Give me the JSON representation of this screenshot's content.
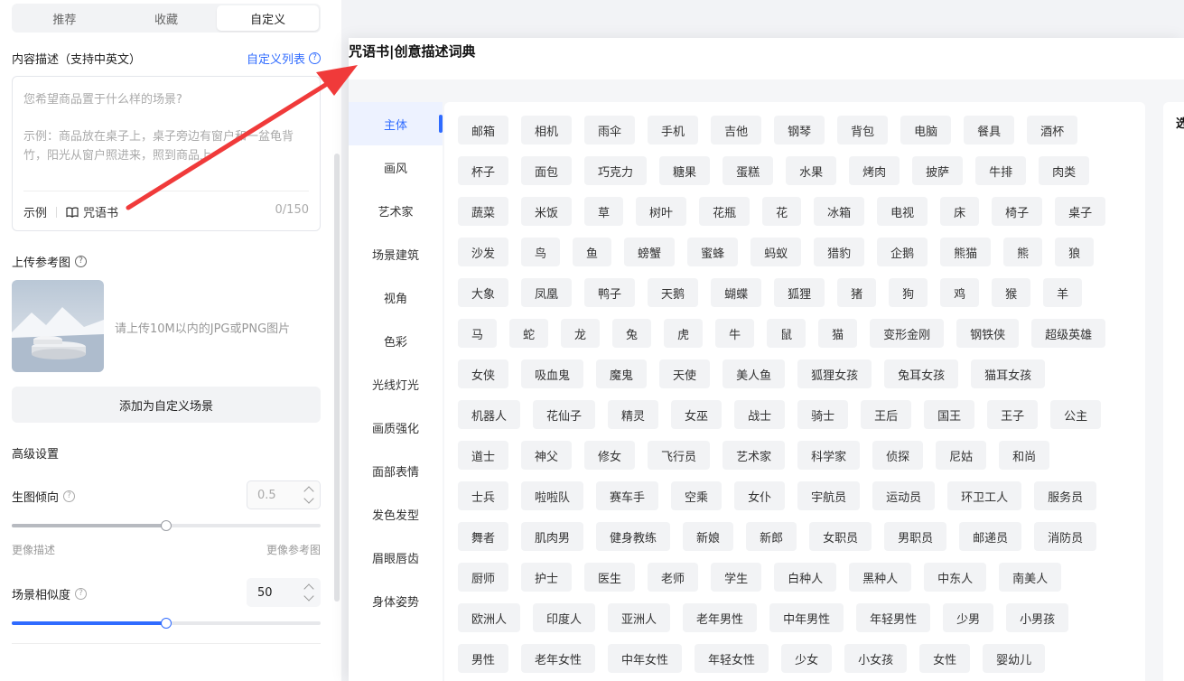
{
  "left_panel": {
    "tabs": [
      {
        "label": "推荐",
        "active": false
      },
      {
        "label": "收藏",
        "active": false
      },
      {
        "label": "自定义",
        "active": true
      }
    ],
    "content_desc": {
      "label": "内容描述（支持中英文）",
      "custom_list_link": "自定义列表",
      "placeholder": "您希望商品置于什么样的场景?",
      "example_text": "示例：商品放在桌子上，桌子旁边有窗户和一盆龟背竹，阳光从窗户照进来，照到商品上",
      "example_button": "示例",
      "spellbook_button": "咒语书",
      "counter": "0/150"
    },
    "upload": {
      "label": "上传参考图",
      "hint": "请上传10M以内的JPG或PNG图片",
      "add_button": "添加为自定义场景"
    },
    "advanced": {
      "title": "高级设置",
      "tendency": {
        "label": "生图倾向",
        "value": "0.5",
        "slider_fraction": 0.5,
        "left_hint": "更像描述",
        "right_hint": "更像参考图"
      },
      "similarity": {
        "label": "场景相似度",
        "value": "50",
        "slider_fraction": 0.5
      }
    }
  },
  "modal": {
    "title": "咒语书|创意描述词典",
    "categories": [
      {
        "label": "主体",
        "active": true
      },
      {
        "label": "画风",
        "active": false
      },
      {
        "label": "艺术家",
        "active": false
      },
      {
        "label": "场景建筑",
        "active": false
      },
      {
        "label": "视角",
        "active": false
      },
      {
        "label": "色彩",
        "active": false
      },
      {
        "label": "光线灯光",
        "active": false
      },
      {
        "label": "画质强化",
        "active": false
      },
      {
        "label": "面部表情",
        "active": false
      },
      {
        "label": "发色发型",
        "active": false
      },
      {
        "label": "眉眼唇齿",
        "active": false
      },
      {
        "label": "身体姿势",
        "active": false
      }
    ],
    "tag_rows": [
      [
        "邮箱",
        "相机",
        "雨伞",
        "手机",
        "吉他",
        "钢琴",
        "背包",
        "电脑",
        "餐具",
        "酒杯"
      ],
      [
        "杯子",
        "面包",
        "巧克力",
        "糖果",
        "蛋糕",
        "水果",
        "烤肉",
        "披萨",
        "牛排",
        "肉类"
      ],
      [
        "蔬菜",
        "米饭",
        "草",
        "树叶",
        "花瓶",
        "花",
        "冰箱",
        "电视",
        "床",
        "椅子",
        "桌子"
      ],
      [
        "沙发",
        "鸟",
        "鱼",
        "螃蟹",
        "蜜蜂",
        "蚂蚁",
        "猎豹",
        "企鹅",
        "熊猫",
        "熊",
        "狼"
      ],
      [
        "大象",
        "凤凰",
        "鸭子",
        "天鹅",
        "蝴蝶",
        "狐狸",
        "猪",
        "狗",
        "鸡",
        "猴",
        "羊"
      ],
      [
        "马",
        "蛇",
        "龙",
        "兔",
        "虎",
        "牛",
        "鼠",
        "猫",
        "变形金刚",
        "钢铁侠",
        "超级英雄"
      ],
      [
        "女侠",
        "吸血鬼",
        "魔鬼",
        "天使",
        "美人鱼",
        "狐狸女孩",
        "兔耳女孩",
        "猫耳女孩"
      ],
      [
        "机器人",
        "花仙子",
        "精灵",
        "女巫",
        "战士",
        "骑士",
        "王后",
        "国王",
        "王子",
        "公主"
      ],
      [
        "道士",
        "神父",
        "修女",
        "飞行员",
        "艺术家",
        "科学家",
        "侦探",
        "尼姑",
        "和尚"
      ],
      [
        "士兵",
        "啦啦队",
        "赛车手",
        "空乘",
        "女仆",
        "宇航员",
        "运动员",
        "环卫工人",
        "服务员"
      ],
      [
        "舞者",
        "肌肉男",
        "健身教练",
        "新娘",
        "新郎",
        "女职员",
        "男职员",
        "邮递员",
        "消防员"
      ],
      [
        "厨师",
        "护士",
        "医生",
        "老师",
        "学生",
        "白种人",
        "黑种人",
        "中东人",
        "南美人"
      ],
      [
        "欧洲人",
        "印度人",
        "亚洲人",
        "老年男性",
        "中年男性",
        "年轻男性",
        "少男",
        "小男孩"
      ],
      [
        "男性",
        "老年女性",
        "中年女性",
        "年轻女性",
        "少女",
        "小女孩",
        "女性",
        "婴幼儿"
      ]
    ],
    "right_panel_text": "选"
  },
  "colors": {
    "accent": "#2f6bff",
    "annotation_arrow": "#f03a3a",
    "slider_grey": "#b7bac0"
  }
}
